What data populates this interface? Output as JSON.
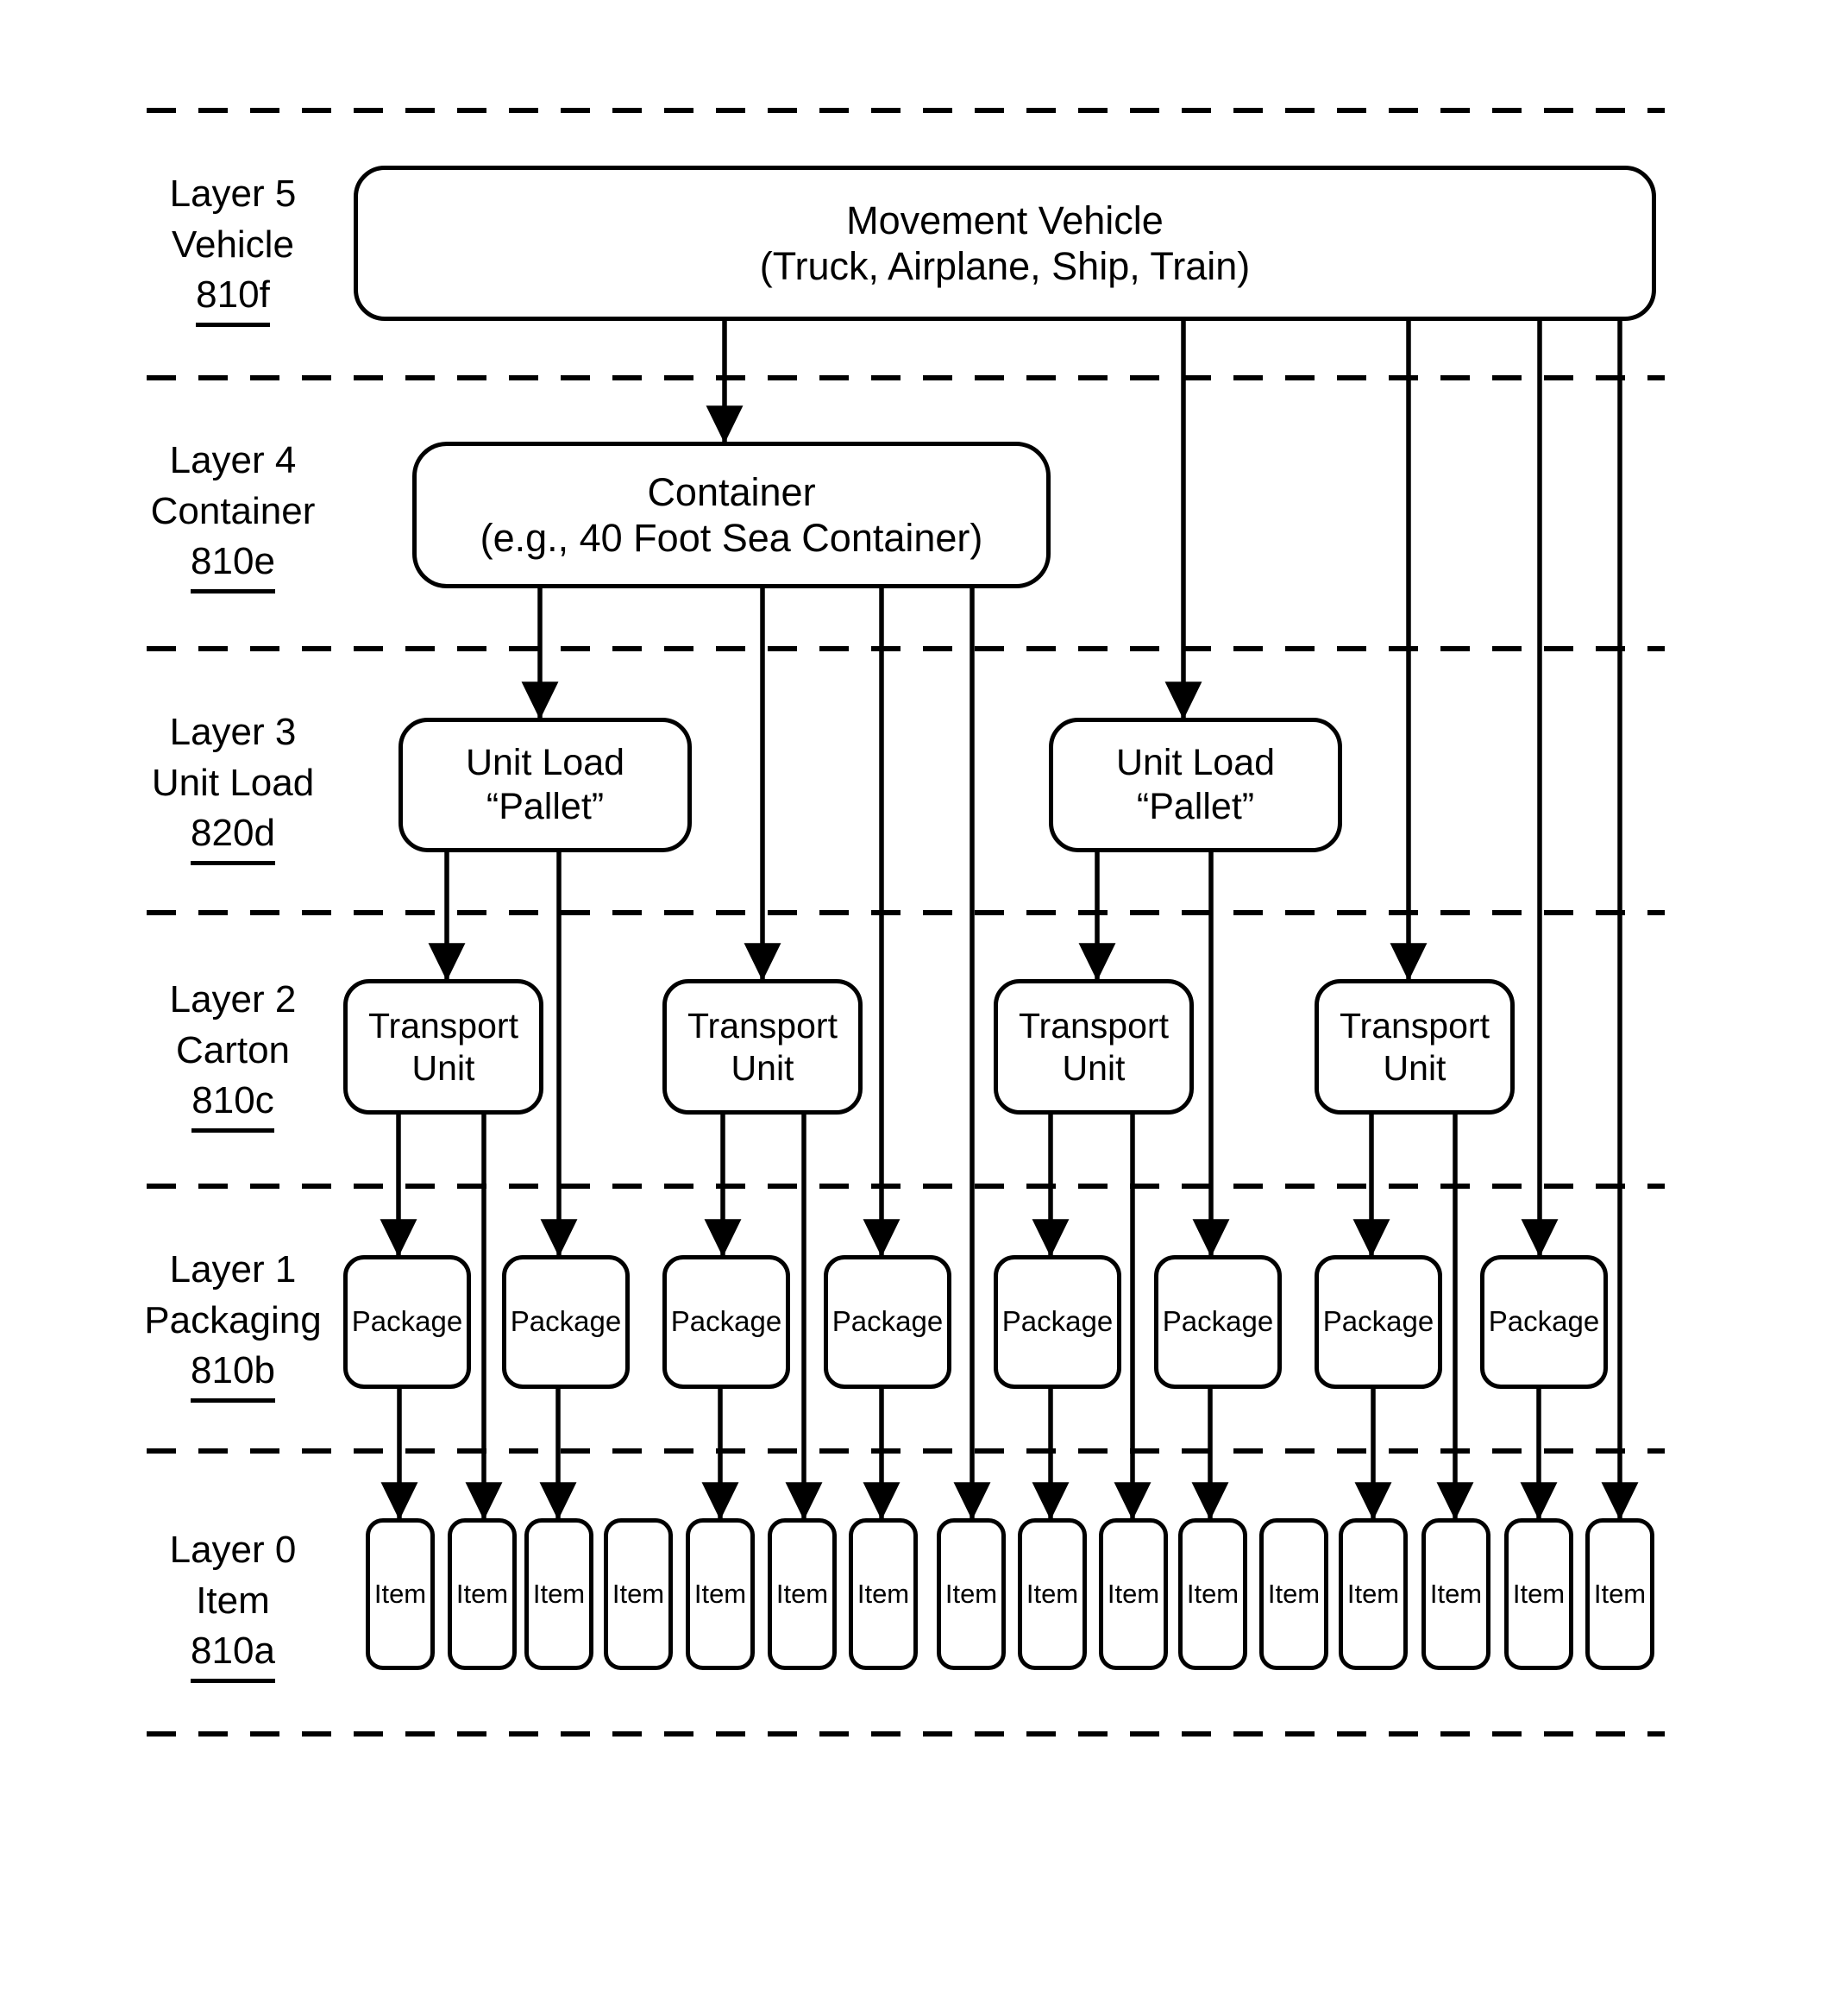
{
  "figure": {
    "type": "layered-block-diagram",
    "description": "Logistics packaging hierarchy layers 0 through 5"
  },
  "layers": [
    {
      "id": "layer5",
      "name": "Layer 5",
      "subtitle": "Vehicle",
      "ref": "810f"
    },
    {
      "id": "layer4",
      "name": "Layer 4",
      "subtitle": "Container",
      "ref": "810e"
    },
    {
      "id": "layer3",
      "name": "Layer 3",
      "subtitle": "Unit Load",
      "ref": "820d"
    },
    {
      "id": "layer2",
      "name": "Layer 2",
      "subtitle": "Carton",
      "ref": "810c"
    },
    {
      "id": "layer1",
      "name": "Layer 1",
      "subtitle": "Packaging",
      "ref": "810b"
    },
    {
      "id": "layer0",
      "name": "Layer 0",
      "subtitle": "Item",
      "ref": "810a"
    }
  ],
  "nodes": {
    "vehicle": {
      "line1": "Movement Vehicle",
      "line2": "(Truck, Airplane, Ship, Train)"
    },
    "container": {
      "line1": "Container",
      "line2": "(e.g., 40 Foot Sea Container)"
    },
    "unit_loads": [
      {
        "line1": "Unit Load",
        "line2": "“Pallet”"
      },
      {
        "line1": "Unit Load",
        "line2": "“Pallet”"
      }
    ],
    "transport_units": [
      {
        "line1": "Transport",
        "line2": "Unit"
      },
      {
        "line1": "Transport",
        "line2": "Unit"
      },
      {
        "line1": "Transport",
        "line2": "Unit"
      },
      {
        "line1": "Transport",
        "line2": "Unit"
      }
    ],
    "packages": [
      {
        "label": "Package"
      },
      {
        "label": "Package"
      },
      {
        "label": "Package"
      },
      {
        "label": "Package"
      },
      {
        "label": "Package"
      },
      {
        "label": "Package"
      },
      {
        "label": "Package"
      },
      {
        "label": "Package"
      }
    ],
    "items": [
      {
        "label": "Item"
      },
      {
        "label": "Item"
      },
      {
        "label": "Item"
      },
      {
        "label": "Item"
      },
      {
        "label": "Item"
      },
      {
        "label": "Item"
      },
      {
        "label": "Item"
      },
      {
        "label": "Item"
      },
      {
        "label": "Item"
      },
      {
        "label": "Item"
      },
      {
        "label": "Item"
      },
      {
        "label": "Item"
      },
      {
        "label": "Item"
      },
      {
        "label": "Item"
      },
      {
        "label": "Item"
      },
      {
        "label": "Item"
      }
    ]
  },
  "colors": {
    "stroke": "#000000",
    "background": "#ffffff"
  }
}
